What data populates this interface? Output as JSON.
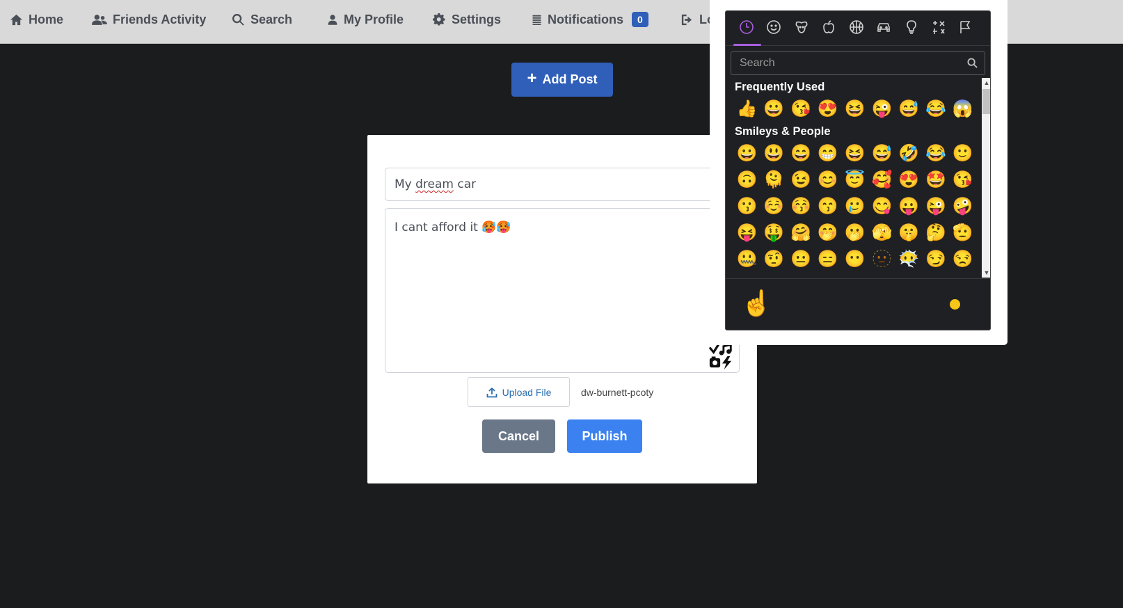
{
  "nav": {
    "home": "Home",
    "friends": "Friends Activity",
    "search": "Search",
    "profile": "My Profile",
    "settings": "Settings",
    "notifications": "Notifications",
    "notif_count": "0",
    "logout": "Lo"
  },
  "add_post_label": "Add Post",
  "post": {
    "title_before": "My ",
    "title_spell": "dream",
    "title_after": " car",
    "body": "I cant afford it 🥵🥵",
    "upload_label": "Upload File",
    "file_name": "dw-burnett-pcoty",
    "cancel": "Cancel",
    "publish": "Publish"
  },
  "emoji_picker": {
    "search_placeholder": "Search",
    "categories": [
      "recent-icon",
      "smiley-icon",
      "animal-icon",
      "food-icon",
      "activity-icon",
      "travel-icon",
      "objects-icon",
      "symbols-icon",
      "flags-icon"
    ],
    "frequently_used_title": "Frequently Used",
    "frequently_used": [
      "👍",
      "😀",
      "😘",
      "😍",
      "😆",
      "😜",
      "😅",
      "😂",
      "😱"
    ],
    "smileys_title": "Smileys & People",
    "smileys_rows": [
      [
        "😀",
        "😃",
        "😄",
        "😁",
        "😆",
        "😅",
        "🤣",
        "😂",
        "🙂"
      ],
      [
        "🙃",
        "🫠",
        "😉",
        "😊",
        "😇",
        "🥰",
        "😍",
        "🤩",
        "😘"
      ],
      [
        "😗",
        "☺️",
        "😚",
        "😙",
        "🥲",
        "😋",
        "😛",
        "😜",
        "🤪"
      ],
      [
        "😝",
        "🤑",
        "🤗",
        "🤭",
        "🫢",
        "🫣",
        "🤫",
        "🤔",
        "🫡"
      ],
      [
        "🤐",
        "🤨",
        "😐",
        "😑",
        "😶",
        "🫥",
        "😶‍🌫️",
        "😏",
        "😒"
      ]
    ],
    "preview_emoji": "☝️",
    "skin_tone_color": "#f5c518"
  }
}
